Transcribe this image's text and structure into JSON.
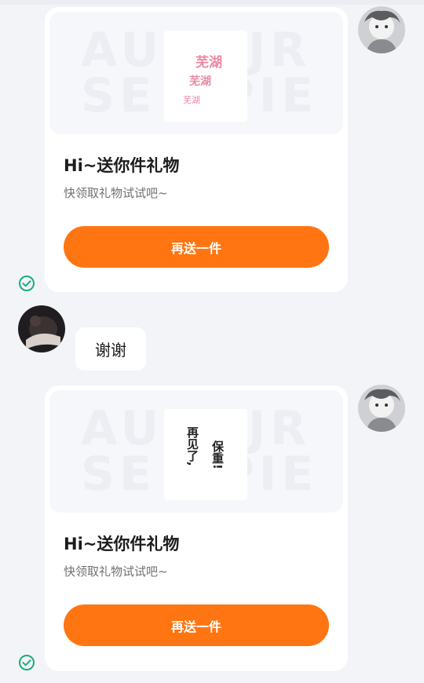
{
  "messages": [
    {
      "type": "gift",
      "sender": "self",
      "title": "Hi~送你件礼物",
      "subtitle": "快领取礼物试试吧~",
      "button_label": "再送一件",
      "sticker_text": [
        "芜湖",
        "芜湖",
        "芜湖"
      ],
      "status": "sent"
    },
    {
      "type": "text",
      "sender": "other",
      "text": "谢谢"
    },
    {
      "type": "gift",
      "sender": "self",
      "title": "Hi~送你件礼物",
      "subtitle": "快领取礼物试试吧~",
      "button_label": "再送一件",
      "sticker_text": [
        "再见了,",
        "保重!"
      ],
      "status": "sent"
    }
  ],
  "colors": {
    "accent": "#ff7512",
    "check": "#1aad7a",
    "sticker_pink": "#e98aa3",
    "background": "#f3f4f8"
  },
  "icons": {
    "status": "check-circle-icon"
  }
}
